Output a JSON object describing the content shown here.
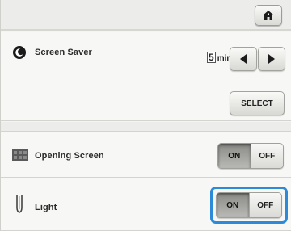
{
  "top_bar": {
    "home_icon": "home-icon"
  },
  "screen_saver": {
    "label": "Screen Saver",
    "icon": "screen-saver-icon",
    "minutes_value": "5",
    "minutes_unit": "min",
    "decrease_icon": "triangle-left-icon",
    "increase_icon": "triangle-right-icon",
    "select_label": "SELECT"
  },
  "opening_screen": {
    "label": "Opening Screen",
    "icon": "opening-screen-icon",
    "on_label": "ON",
    "off_label": "OFF",
    "selected": "ON"
  },
  "light": {
    "label": "Light",
    "icon": "light-icon",
    "on_label": "ON",
    "off_label": "OFF",
    "selected": "ON"
  },
  "colors": {
    "highlight": "#2d8ad8",
    "background": "#f4f4f2"
  }
}
